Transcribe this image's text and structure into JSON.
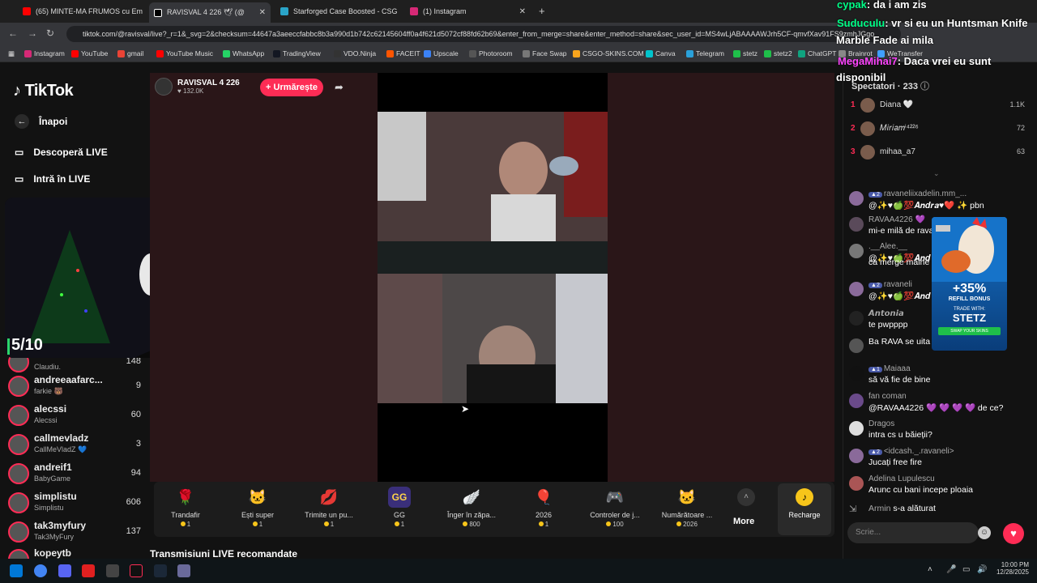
{
  "tabs": [
    {
      "title": "(65) MINTE-MA FRUMOS cu Em",
      "color": "#ff0000"
    },
    {
      "title": "RAVISVAL 4 226 🕊 (@",
      "color": "#000000"
    },
    {
      "title": "Starforged Case Boosted - CSG",
      "color": "#2aa4c8"
    },
    {
      "title": "(1) Instagram",
      "color": "#d62976"
    }
  ],
  "url": "tiktok.com/@ravisval/live?_r=1&_svg=2&checksum=44647a3aeeccfabbc8b3a990d1b742c62145604ff0a4f621d5072cf88fd62b69&enter_from_merge=share&enter_method=share&sec_user_id=MS4wLjABAAAAWJrh5CF-qmvfXav91FS9zmhJGgo",
  "bookmarks": [
    "Instagram",
    "YouTube",
    "gmail",
    "YouTube Music",
    "WhatsApp",
    "TradingView",
    "VDO.Ninja",
    "FACEIT",
    "Upscale",
    "Photoroom",
    "Face Swap",
    "CSGO-SKINS.COM",
    "Canva",
    "Telegram",
    "stetz",
    "stetz2",
    "ChatGPT",
    "Brainrot",
    "WeTransfer"
  ],
  "nav": {
    "logo": "TikTok",
    "back": "Înapoi",
    "discover": "Descoperă LIVE",
    "enter": "Intră în LIVE"
  },
  "overlay": {
    "rating": "5/10"
  },
  "creators": [
    {
      "name": "",
      "sub": "Claudiu.",
      "count": "148"
    },
    {
      "name": "andreeaafarc...",
      "sub": "farkie 🐻",
      "count": "9"
    },
    {
      "name": "alecssi",
      "sub": "Alecssi",
      "count": "60"
    },
    {
      "name": "callmevladz",
      "sub": "CallMeVladZ 💙",
      "count": "3"
    },
    {
      "name": "andreif1",
      "sub": "BabyGame",
      "count": "94"
    },
    {
      "name": "simplistu",
      "sub": "Simplistu",
      "count": "606"
    },
    {
      "name": "tak3myfury",
      "sub": "Tak3MyFury",
      "count": "137"
    },
    {
      "name": "kopeytb",
      "sub": "",
      "count": ""
    }
  ],
  "host": {
    "name": "RAVISVAL 4 226",
    "likes": "132.0K",
    "follow": "+ Urmărește"
  },
  "gifts": [
    {
      "name": "Trandafir",
      "price": "1",
      "icon": "🌹"
    },
    {
      "name": "Ești super",
      "price": "1",
      "icon": "🐱"
    },
    {
      "name": "Trimite un pu...",
      "price": "1",
      "icon": "💋"
    },
    {
      "name": "GG",
      "price": "1",
      "icon": "GG"
    },
    {
      "name": "Înger în zăpa...",
      "price": "800",
      "icon": "🪽"
    },
    {
      "name": "2026",
      "price": "1",
      "icon": "🎈"
    },
    {
      "name": "Controler de j...",
      "price": "100",
      "icon": "🎮"
    },
    {
      "name": "Numărătoare ...",
      "price": "2026",
      "icon": "🐱"
    }
  ],
  "giftbar": {
    "more": "More",
    "recharge": "Recharge"
  },
  "recommended": "Transmisiuni LIVE recomandate",
  "stream_overlay": [
    {
      "user": "cypak",
      "text": ": da i am zis",
      "color": "#00ff88"
    },
    {
      "user": "Suduculu",
      "text": ": vr si eu un Huntsman Knife",
      "color": "#00ff88"
    },
    {
      "user": "",
      "text": "Marble Fade ai mila",
      "color": "#ffffff"
    },
    {
      "user": "MegaMihai7",
      "text": ": Daca vrei eu sunt",
      "color": "#ff44ff"
    },
    {
      "user": "",
      "text": "disponibil",
      "color": "#ffffff"
    }
  ],
  "spectators": {
    "label": "Spectatori",
    "count": "233"
  },
  "top_viewers": [
    {
      "rank": "1",
      "name": "Diana 🤍",
      "count": "1.1K"
    },
    {
      "rank": "2",
      "name": "𝑀𝑖𝑟𝑖𝑎𝑚ⁱ⁴²²⁶",
      "count": "72"
    },
    {
      "rank": "3",
      "name": "mihaa_a7",
      "count": "63"
    }
  ],
  "chat": [
    {
      "name": "ravaneliixadelin.mm_...",
      "level": "2",
      "text": "@✨♥🍏💯𝑨𝒏𝒅𝒓𝒂♥❤️ ✨ pbn"
    },
    {
      "name": "RAVAA4226 💜",
      "level": "",
      "text": "mi-e milă de rava"
    },
    {
      "name": ".__Alee.__",
      "level": "",
      "text": "@✨♥🍏💯𝑨𝒏𝒅"
    },
    {
      "name": "",
      "level": "",
      "text": "ca merge mâine"
    },
    {
      "name": "ravaneli",
      "level": "2",
      "text": "@✨♥🍏💯𝑨𝒏𝒅"
    },
    {
      "name": "𝘼𝙣𝙩𝙤𝙣𝙞𝙖",
      "level": "",
      "text": "te pwpppp"
    },
    {
      "name": "",
      "level": "",
      "text": "Ba RAVA se uita in gol?"
    },
    {
      "name": "Maiaaa",
      "level": "1",
      "text": "să vă fie de bine"
    },
    {
      "name": "fan coman",
      "level": "",
      "text": "@RAVAA4226 💜 💜 💜 💜 de ce?"
    },
    {
      "name": "Dragos",
      "level": "",
      "text": "intra cs u băieții?"
    },
    {
      "name": "<idcash._.ravaneli>",
      "level": "2",
      "text": "Jucați free fire"
    },
    {
      "name": "Adelina Lupulescu",
      "level": "",
      "text": "Arunc cu bani incepe ploaia"
    },
    {
      "name": "Armin",
      "level": "",
      "text": "s-a alăturat"
    }
  ],
  "ad": {
    "percent": "+35%",
    "line1": "REFILL BONUS",
    "line2": "TRADE WITH:",
    "brand": "STETZ",
    "cta": "SWAP YOUR SKINS"
  },
  "chat_input": {
    "placeholder": "Scrie..."
  },
  "clock": {
    "time": "10:00 PM",
    "date": "12/28/2025"
  }
}
